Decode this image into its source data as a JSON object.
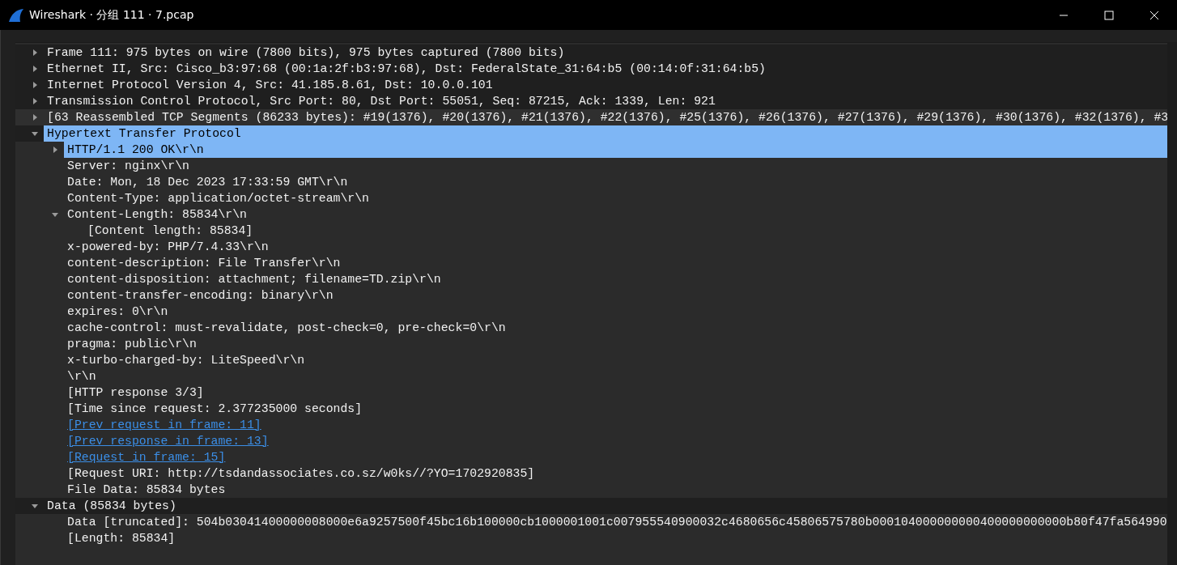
{
  "window": {
    "title": "Wireshark · 分组 111 · 7.pcap"
  },
  "tree": [
    {
      "label": "Frame 111: 975 bytes on wire (7800 bits), 975 bytes captured (7800 bits)",
      "kind": "field",
      "expanded": false,
      "selected": false,
      "hovered": false
    },
    {
      "label": "Ethernet II, Src: Cisco_b3:97:68 (00:1a:2f:b3:97:68), Dst: FederalState_31:64:b5 (00:14:0f:31:64:b5)",
      "kind": "field",
      "expanded": false,
      "selected": false,
      "hovered": false
    },
    {
      "label": "Internet Protocol Version 4, Src: 41.185.8.61, Dst: 10.0.0.101",
      "kind": "field",
      "expanded": false,
      "selected": false,
      "hovered": false
    },
    {
      "label": "Transmission Control Protocol, Src Port: 80, Dst Port: 55051, Seq: 87215, Ack: 1339, Len: 921",
      "kind": "field",
      "expanded": false,
      "selected": false,
      "hovered": false
    },
    {
      "label": "[63 Reassembled TCP Segments (86233 bytes): #19(1376), #20(1376), #21(1376), #22(1376), #25(1376), #26(1376), #27(1376), #29(1376), #30(1376), #32(1376), #3",
      "kind": "field",
      "expanded": false,
      "selected": false,
      "hovered": true
    },
    {
      "label": "Hypertext Transfer Protocol",
      "kind": "field",
      "expanded": true,
      "selected": true,
      "hovered": false,
      "children": [
        {
          "label": "HTTP/1.1 200 OK\\r\\n",
          "kind": "field",
          "expanded": false,
          "selected": true
        },
        {
          "label": "Server: nginx\\r\\n",
          "kind": "field",
          "selected": false
        },
        {
          "label": "Date: Mon, 18 Dec 2023 17:33:59 GMT\\r\\n",
          "kind": "field",
          "selected": false
        },
        {
          "label": "Content-Type: application/octet-stream\\r\\n",
          "kind": "field",
          "selected": false
        },
        {
          "label": "Content-Length: 85834\\r\\n",
          "kind": "field",
          "expanded": true,
          "selected": false,
          "children": [
            {
              "label": "[Content length: 85834]",
              "kind": "field",
              "selected": false
            }
          ]
        },
        {
          "label": "x-powered-by: PHP/7.4.33\\r\\n",
          "kind": "field",
          "selected": false
        },
        {
          "label": "content-description: File Transfer\\r\\n",
          "kind": "field",
          "selected": false
        },
        {
          "label": "content-disposition: attachment; filename=TD.zip\\r\\n",
          "kind": "field",
          "selected": false
        },
        {
          "label": "content-transfer-encoding: binary\\r\\n",
          "kind": "field",
          "selected": false
        },
        {
          "label": "expires: 0\\r\\n",
          "kind": "field",
          "selected": false
        },
        {
          "label": "cache-control: must-revalidate, post-check=0, pre-check=0\\r\\n",
          "kind": "field",
          "selected": false
        },
        {
          "label": "pragma: public\\r\\n",
          "kind": "field",
          "selected": false
        },
        {
          "label": "x-turbo-charged-by: LiteSpeed\\r\\n",
          "kind": "field",
          "selected": false
        },
        {
          "label": "\\r\\n",
          "kind": "field",
          "selected": false
        },
        {
          "label": "[HTTP response 3/3]",
          "kind": "field",
          "selected": false
        },
        {
          "label": "[Time since request: 2.377235000 seconds]",
          "kind": "field",
          "selected": false
        },
        {
          "label": "[Prev request in frame: 11]",
          "kind": "link",
          "selected": false
        },
        {
          "label": "[Prev response in frame: 13]",
          "kind": "link",
          "selected": false
        },
        {
          "label": "[Request in frame: 15]",
          "kind": "link",
          "selected": false
        },
        {
          "label": "[Request URI: http://tsdandassociates.co.sz/w0ks//?YO=1702920835]",
          "kind": "field",
          "selected": false
        },
        {
          "label": "File Data: 85834 bytes",
          "kind": "field",
          "selected": false
        }
      ]
    },
    {
      "label": "Data (85834 bytes)",
      "kind": "field",
      "expanded": true,
      "selected": false,
      "hovered": false,
      "children": [
        {
          "label": "Data [truncated]: 504b03041400000008000e6a9257500f45bc16b100000cb1000001001c007955540900032c4680656c45806575780b000104000000000400000000000b80f47fa564990",
          "kind": "field",
          "selected": false
        },
        {
          "label": "[Length: 85834]",
          "kind": "field",
          "selected": false
        }
      ]
    }
  ]
}
